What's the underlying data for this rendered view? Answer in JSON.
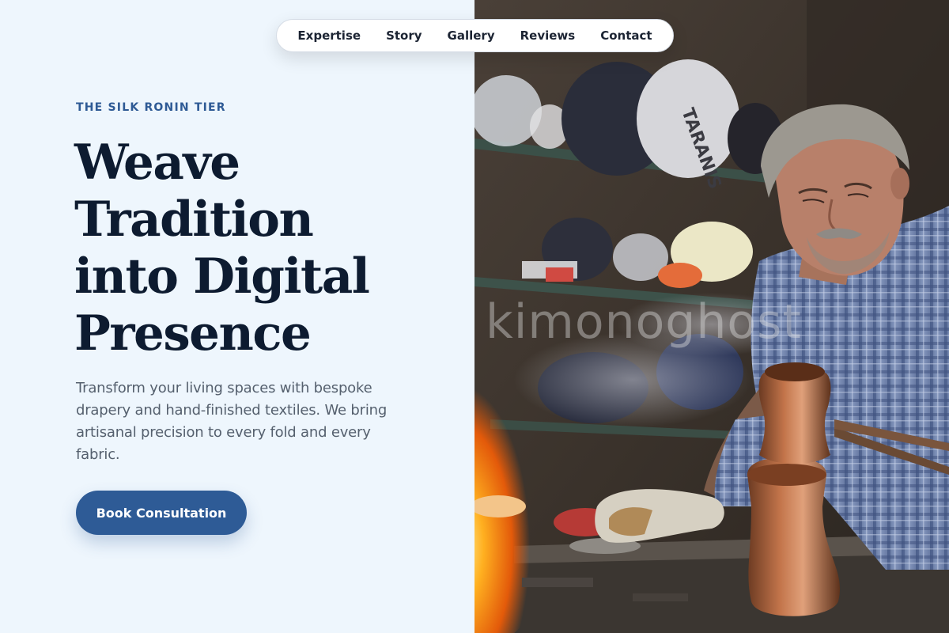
{
  "nav": {
    "items": [
      {
        "label": "Expertise"
      },
      {
        "label": "Story"
      },
      {
        "label": "Gallery"
      },
      {
        "label": "Reviews"
      },
      {
        "label": "Contact"
      }
    ]
  },
  "hero": {
    "eyebrow": "THE SILK RONIN TIER",
    "headline_lines": [
      "Weave",
      "Tradition",
      "into Digital",
      "Presence"
    ],
    "lede": "Transform your living spaces with bespoke drapery and hand-finished textiles. We bring artisanal precision to every fold and every fabric.",
    "cta_label": "Book Consultation"
  },
  "photo": {
    "watermark": "kimonoghost",
    "bag_label": "TARANIS"
  },
  "colors": {
    "page_bg": "#eef6fd",
    "eyebrow": "#2e5a95",
    "headline": "#0d1b30",
    "body_text": "#55606e",
    "cta_bg": "#2e5b96",
    "cta_text": "#ffffff"
  }
}
